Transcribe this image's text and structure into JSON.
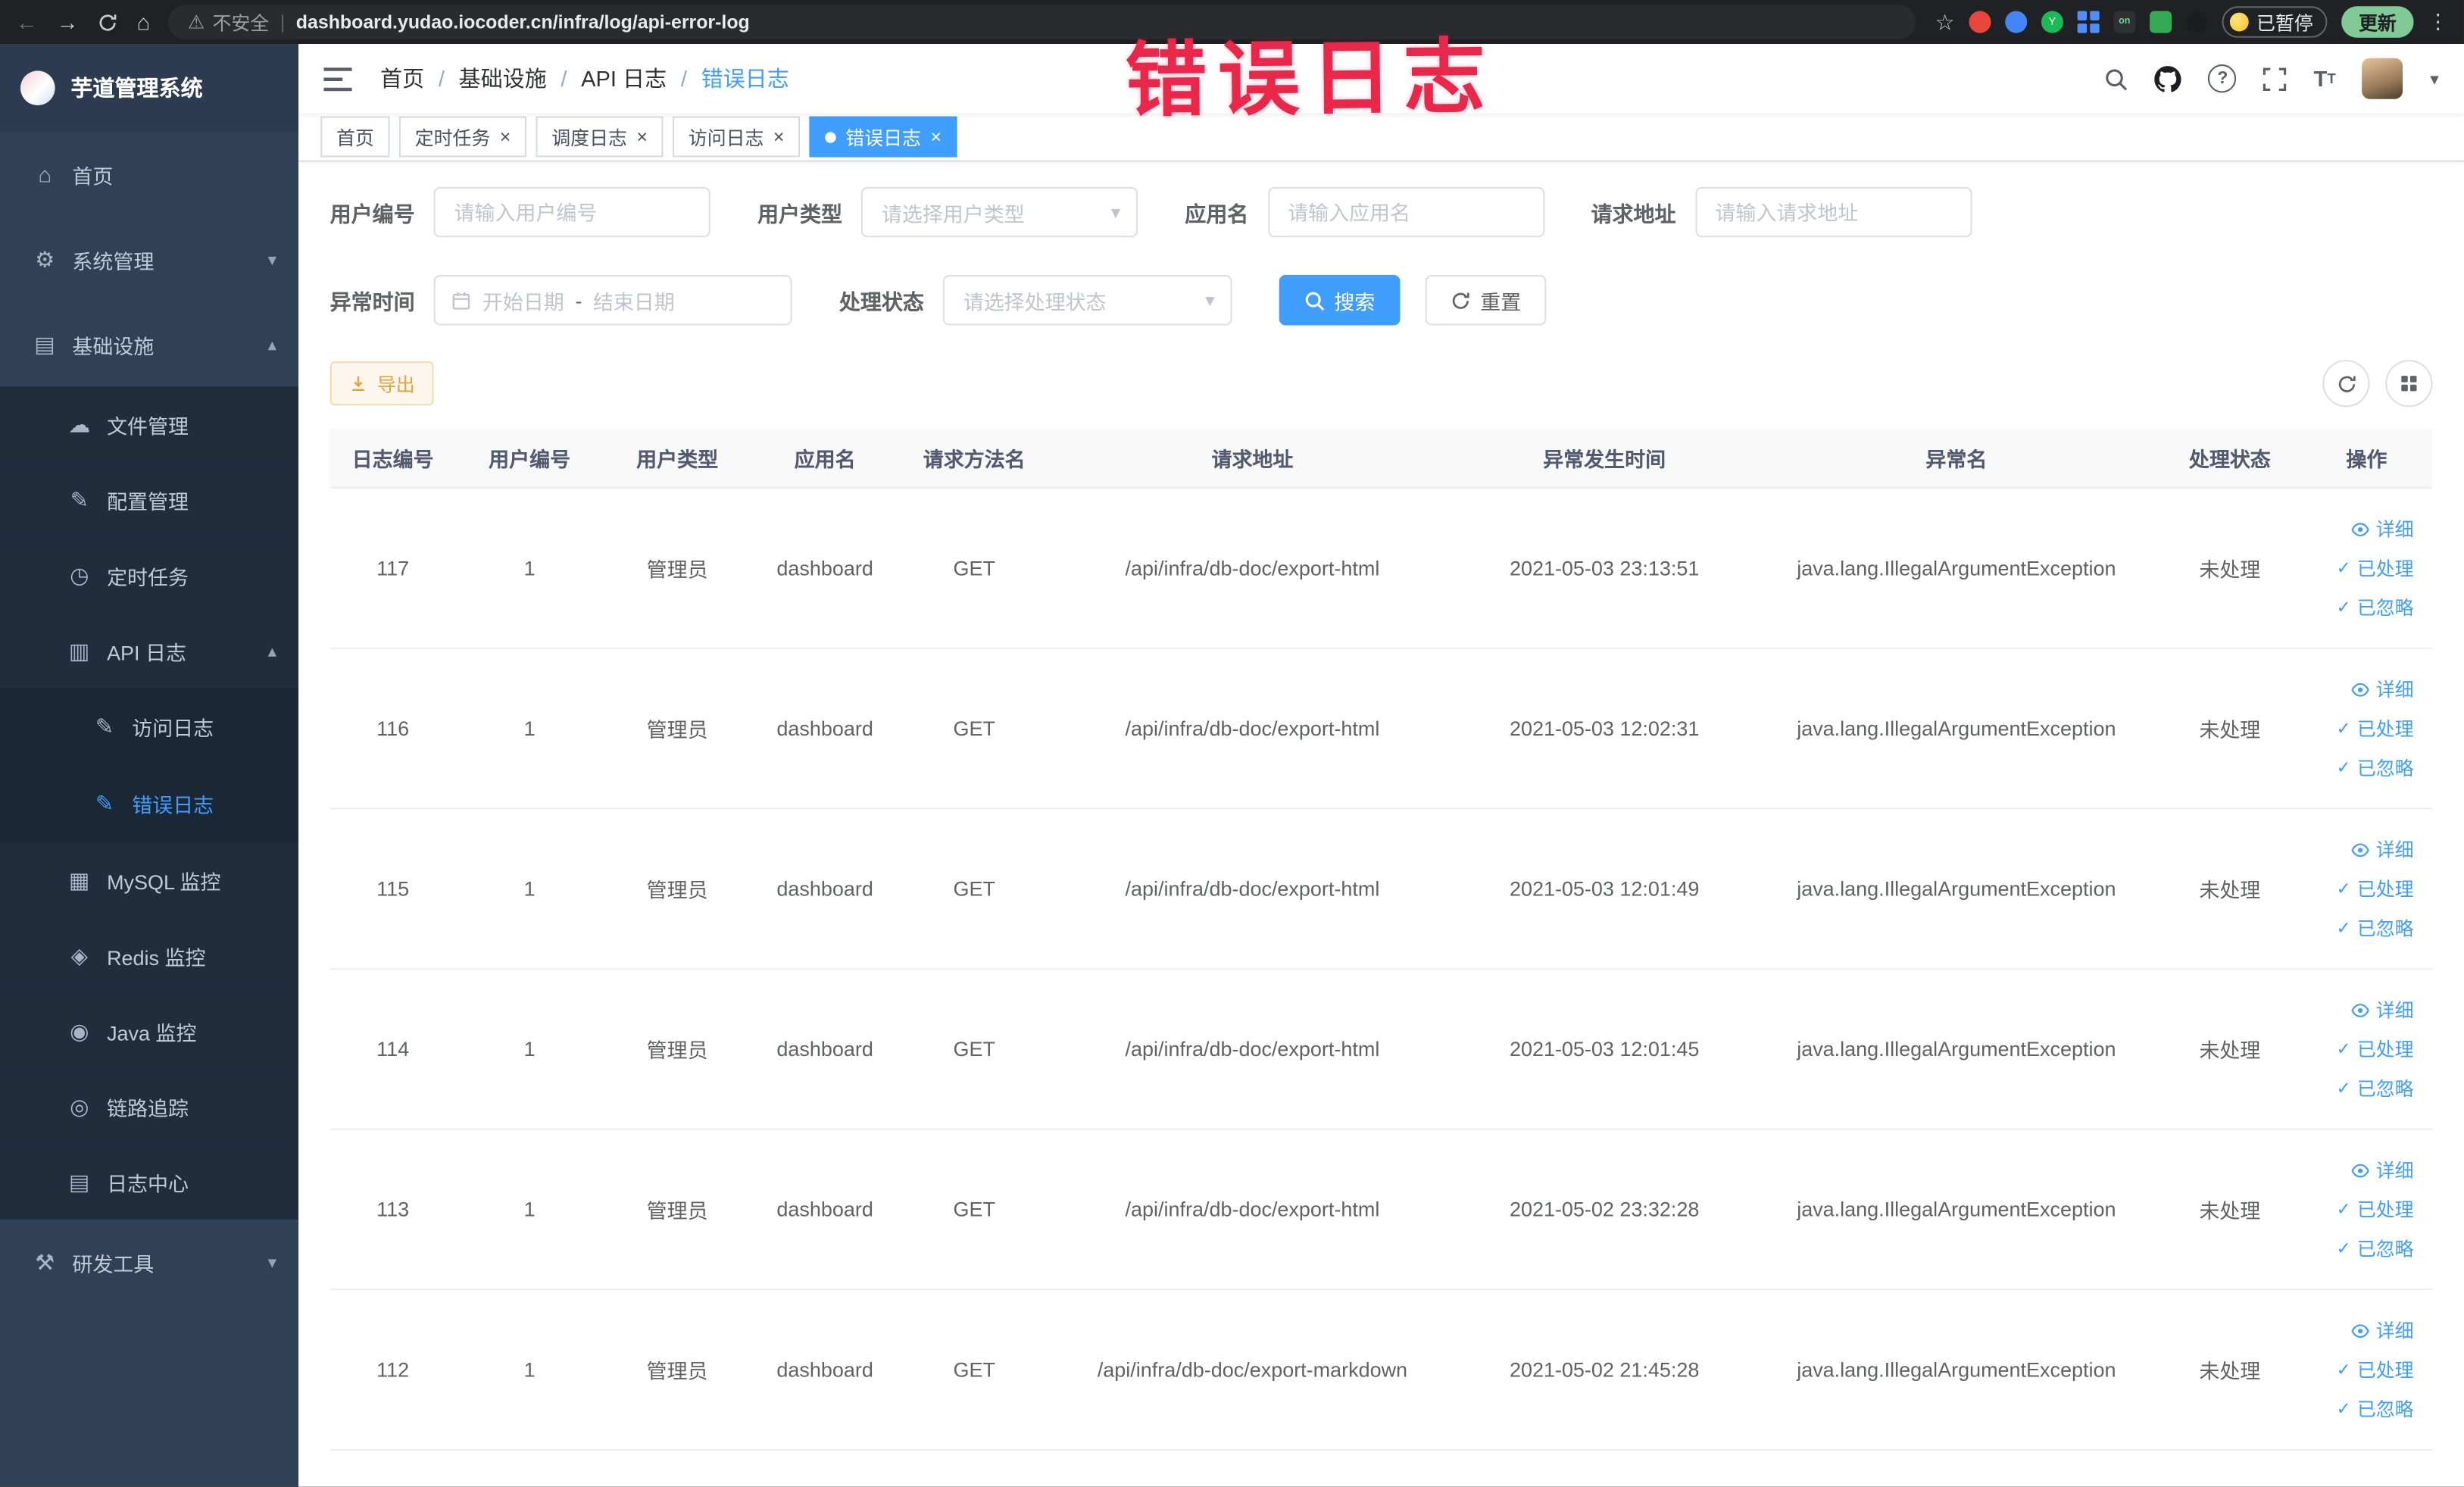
{
  "browser": {
    "security_label": "不安全",
    "url": "dashboard.yudao.iocoder.cn/infra/log/api-error-log",
    "paused_chip_label": "已暂停",
    "update_button_label": "更新"
  },
  "annotation": {
    "text": "错误日志"
  },
  "colors": {
    "accent": "#409eff",
    "warning": "#e6a23c",
    "annotation_red": "#e8274b",
    "sidebar_bg": "#304156",
    "submenu_bg": "#1f2d3d"
  },
  "sidebar": {
    "title": "芋道管理系统",
    "items": [
      {
        "label": "首页",
        "icon": "home-icon"
      },
      {
        "label": "系统管理",
        "icon": "gear-icon"
      },
      {
        "label": "基础设施",
        "icon": "infrastructure-icon"
      },
      {
        "label": "文件管理",
        "icon": "file-management-icon"
      },
      {
        "label": "配置管理",
        "icon": "config-management-icon"
      },
      {
        "label": "定时任务",
        "icon": "scheduled-task-icon"
      },
      {
        "label": "API 日志",
        "icon": "api-log-icon"
      },
      {
        "label": "访问日志",
        "icon": "access-log-icon"
      },
      {
        "label": "错误日志",
        "icon": "error-log-icon"
      },
      {
        "label": "MySQL 监控",
        "icon": "mysql-monitor-icon"
      },
      {
        "label": "Redis 监控",
        "icon": "redis-monitor-icon"
      },
      {
        "label": "Java 监控",
        "icon": "java-monitor-icon"
      },
      {
        "label": "链路追踪",
        "icon": "trace-icon"
      },
      {
        "label": "日志中心",
        "icon": "log-center-icon"
      },
      {
        "label": "研发工具",
        "icon": "devtools-icon"
      }
    ]
  },
  "header": {
    "breadcrumb": [
      "首页",
      "基础设施",
      "API 日志",
      "错误日志"
    ]
  },
  "tabs": [
    {
      "label": "首页"
    },
    {
      "label": "定时任务"
    },
    {
      "label": "调度日志"
    },
    {
      "label": "访问日志"
    },
    {
      "label": "错误日志"
    }
  ],
  "filters": {
    "user_id": {
      "label": "用户编号",
      "placeholder": "请输入用户编号"
    },
    "user_type": {
      "label": "用户类型",
      "placeholder": "请选择用户类型"
    },
    "app_name": {
      "label": "应用名",
      "placeholder": "请输入应用名"
    },
    "request_url": {
      "label": "请求地址",
      "placeholder": "请输入请求地址"
    },
    "exception_time": {
      "label": "异常时间",
      "start_placeholder": "开始日期",
      "separator": "-",
      "end_placeholder": "结束日期"
    },
    "process_status": {
      "label": "处理状态",
      "placeholder": "请选择处理状态"
    },
    "search_button": "搜索",
    "reset_button": "重置"
  },
  "toolbar": {
    "export_label": "导出"
  },
  "table": {
    "headers": [
      "日志编号",
      "用户编号",
      "用户类型",
      "应用名",
      "请求方法名",
      "请求地址",
      "异常发生时间",
      "异常名",
      "处理状态",
      "操作"
    ],
    "actions": {
      "detail": "详细",
      "processed": "已处理",
      "ignored": "已忽略"
    },
    "rows": [
      {
        "log_id": "117",
        "user_id": "1",
        "user_type": "管理员",
        "app_name": "dashboard",
        "method": "GET",
        "url": "/api/infra/db-doc/export-html",
        "time": "2021-05-03 23:13:51",
        "exception": "java.lang.IllegalArgumentException",
        "status": "未处理"
      },
      {
        "log_id": "116",
        "user_id": "1",
        "user_type": "管理员",
        "app_name": "dashboard",
        "method": "GET",
        "url": "/api/infra/db-doc/export-html",
        "time": "2021-05-03 12:02:31",
        "exception": "java.lang.IllegalArgumentException",
        "status": "未处理"
      },
      {
        "log_id": "115",
        "user_id": "1",
        "user_type": "管理员",
        "app_name": "dashboard",
        "method": "GET",
        "url": "/api/infra/db-doc/export-html",
        "time": "2021-05-03 12:01:49",
        "exception": "java.lang.IllegalArgumentException",
        "status": "未处理"
      },
      {
        "log_id": "114",
        "user_id": "1",
        "user_type": "管理员",
        "app_name": "dashboard",
        "method": "GET",
        "url": "/api/infra/db-doc/export-html",
        "time": "2021-05-03 12:01:45",
        "exception": "java.lang.IllegalArgumentException",
        "status": "未处理"
      },
      {
        "log_id": "113",
        "user_id": "1",
        "user_type": "管理员",
        "app_name": "dashboard",
        "method": "GET",
        "url": "/api/infra/db-doc/export-html",
        "time": "2021-05-02 23:32:28",
        "exception": "java.lang.IllegalArgumentException",
        "status": "未处理"
      },
      {
        "log_id": "112",
        "user_id": "1",
        "user_type": "管理员",
        "app_name": "dashboard",
        "method": "GET",
        "url": "/api/infra/db-doc/export-markdown",
        "time": "2021-05-02 21:45:28",
        "exception": "java.lang.IllegalArgumentException",
        "status": "未处理"
      }
    ]
  }
}
